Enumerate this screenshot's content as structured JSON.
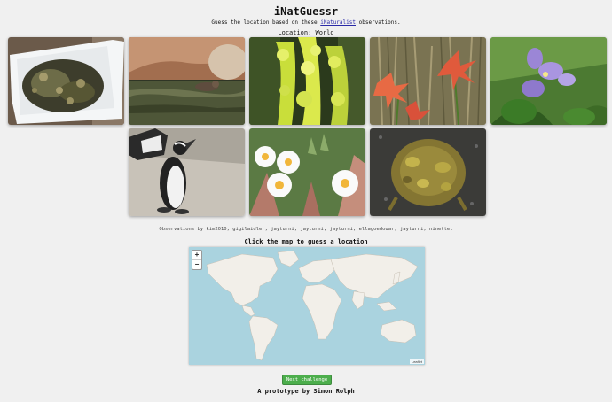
{
  "header": {
    "title": "iNatGuessr",
    "subtitle_before": "Guess the location based on these ",
    "subtitle_link": "iNaturalist",
    "subtitle_after": " observations.",
    "location_label": "Location: World"
  },
  "observations": [
    {
      "subject": "snake in white bucket"
    },
    {
      "subject": "animal swimming in water"
    },
    {
      "subject": "yellow-green flower spikes"
    },
    {
      "subject": "red-orange lilies"
    },
    {
      "subject": "purple flowers"
    },
    {
      "subject": "african penguins"
    },
    {
      "subject": "white daisies"
    },
    {
      "subject": "toad on rock"
    }
  ],
  "credits": "Observations by kim2010, gigilaidler, jayturni, jayturni, jayturni, ellagoedouar, jayturni, ninettet",
  "map": {
    "prompt": "Click the map to guess a location",
    "zoom_in": "+",
    "zoom_out": "−",
    "attribution": "Leaflet",
    "water_color": "#aad3df",
    "land_color": "#f2efe9"
  },
  "actions": {
    "next_label": "Next challenge"
  },
  "footer": {
    "text": "A prototype by Simon Rolph"
  }
}
